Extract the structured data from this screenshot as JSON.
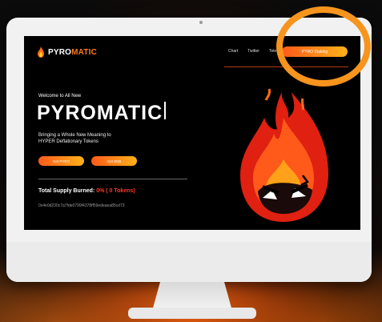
{
  "site": {
    "logo": {
      "text_main": "PYRO",
      "text_accent": "MATIC"
    },
    "nav": {
      "links": [
        "Chart",
        "Twitter",
        "Telegram"
      ],
      "cta_label": "PYRO Staking"
    },
    "hero": {
      "welcome": "Welcome to All New",
      "title": "PYROMATIC",
      "tagline_line1": "Bringing a Whole New Meaning to",
      "tagline_line2": "HYPER Deflationary Tokens",
      "button1": "Get PYRO",
      "button2": "Get BNB"
    },
    "supply": {
      "label": "Total Supply Burned:",
      "value": "0% ( 0 Tokens)"
    },
    "contract_address": "0x4e0d230c7a7fde0799f4378ff59edeaea85cd73"
  },
  "colors": {
    "accent_orange": "#ff7a1a",
    "accent_red": "#ff3b2b",
    "highlight_circle": "#f7941d"
  },
  "icons": {
    "logo": "flame-icon",
    "mascot": "angry-flame-mascot"
  }
}
